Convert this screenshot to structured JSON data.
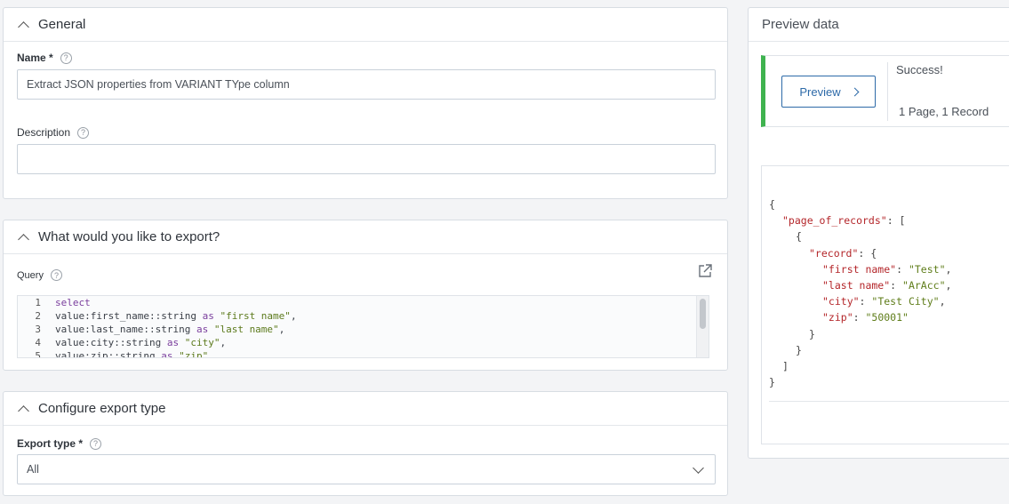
{
  "general": {
    "title": "General",
    "name_label": "Name *",
    "name_value": "Extract JSON properties from VARIANT TYpe column",
    "description_label": "Description",
    "description_value": ""
  },
  "export_section": {
    "title": "What would you like to export?",
    "query_label": "Query",
    "query_lines": [
      {
        "num": "1",
        "tokens": [
          {
            "t": "select",
            "c": "kw"
          }
        ]
      },
      {
        "num": "2",
        "tokens": [
          {
            "t": "value:first_name::string ",
            "c": ""
          },
          {
            "t": "as",
            "c": "kw"
          },
          {
            "t": " ",
            "c": ""
          },
          {
            "t": "\"first name\"",
            "c": "str"
          },
          {
            "t": ",",
            "c": ""
          }
        ]
      },
      {
        "num": "3",
        "tokens": [
          {
            "t": "value:last_name::string ",
            "c": ""
          },
          {
            "t": "as",
            "c": "kw"
          },
          {
            "t": " ",
            "c": ""
          },
          {
            "t": "\"last name\"",
            "c": "str"
          },
          {
            "t": ",",
            "c": ""
          }
        ]
      },
      {
        "num": "4",
        "tokens": [
          {
            "t": "value:city::string ",
            "c": ""
          },
          {
            "t": "as",
            "c": "kw"
          },
          {
            "t": " ",
            "c": ""
          },
          {
            "t": "\"city\"",
            "c": "str"
          },
          {
            "t": ",",
            "c": ""
          }
        ]
      },
      {
        "num": "5",
        "tokens": [
          {
            "t": "value:zip::string ",
            "c": ""
          },
          {
            "t": "as",
            "c": "kw"
          },
          {
            "t": " ",
            "c": ""
          },
          {
            "t": "\"zip\"",
            "c": "str"
          }
        ]
      }
    ]
  },
  "export_type": {
    "title": "Configure export type",
    "label": "Export type *",
    "selected": "All"
  },
  "preview": {
    "title": "Preview data",
    "button_label": "Preview",
    "status": "Success!",
    "summary": "1 Page, 1 Record",
    "status_color": "#3fb34f",
    "json_lines": [
      {
        "indent": 0,
        "tokens": [
          {
            "t": "{",
            "c": ""
          }
        ]
      },
      {
        "indent": 1,
        "tokens": [
          {
            "t": "\"page_of_records\"",
            "c": "jk"
          },
          {
            "t": ": [",
            "c": ""
          }
        ]
      },
      {
        "indent": 2,
        "tokens": [
          {
            "t": "{",
            "c": ""
          }
        ]
      },
      {
        "indent": 3,
        "tokens": [
          {
            "t": "\"record\"",
            "c": "jk"
          },
          {
            "t": ": {",
            "c": ""
          }
        ]
      },
      {
        "indent": 4,
        "tokens": [
          {
            "t": "\"first name\"",
            "c": "jk"
          },
          {
            "t": ": ",
            "c": ""
          },
          {
            "t": "\"Test\"",
            "c": "js"
          },
          {
            "t": ",",
            "c": ""
          }
        ]
      },
      {
        "indent": 4,
        "tokens": [
          {
            "t": "\"last name\"",
            "c": "jk"
          },
          {
            "t": ": ",
            "c": ""
          },
          {
            "t": "\"ArAcc\"",
            "c": "js"
          },
          {
            "t": ",",
            "c": ""
          }
        ]
      },
      {
        "indent": 4,
        "tokens": [
          {
            "t": "\"city\"",
            "c": "jk"
          },
          {
            "t": ": ",
            "c": ""
          },
          {
            "t": "\"Test City\"",
            "c": "js"
          },
          {
            "t": ",",
            "c": ""
          }
        ]
      },
      {
        "indent": 4,
        "tokens": [
          {
            "t": "\"zip\"",
            "c": "jk"
          },
          {
            "t": ": ",
            "c": ""
          },
          {
            "t": "\"50001\"",
            "c": "js"
          }
        ]
      },
      {
        "indent": 3,
        "tokens": [
          {
            "t": "}",
            "c": ""
          }
        ]
      },
      {
        "indent": 2,
        "tokens": [
          {
            "t": "}",
            "c": ""
          }
        ]
      },
      {
        "indent": 1,
        "tokens": [
          {
            "t": "]",
            "c": ""
          }
        ]
      },
      {
        "indent": 0,
        "tokens": [
          {
            "t": "}",
            "c": ""
          }
        ]
      }
    ]
  },
  "icons": {
    "collapse": "chevron-up-icon",
    "help": "help-circle-icon",
    "open_external": "external-link-icon",
    "dropdown": "chevron-down-icon",
    "preview_arrow": "chevron-right-icon"
  }
}
